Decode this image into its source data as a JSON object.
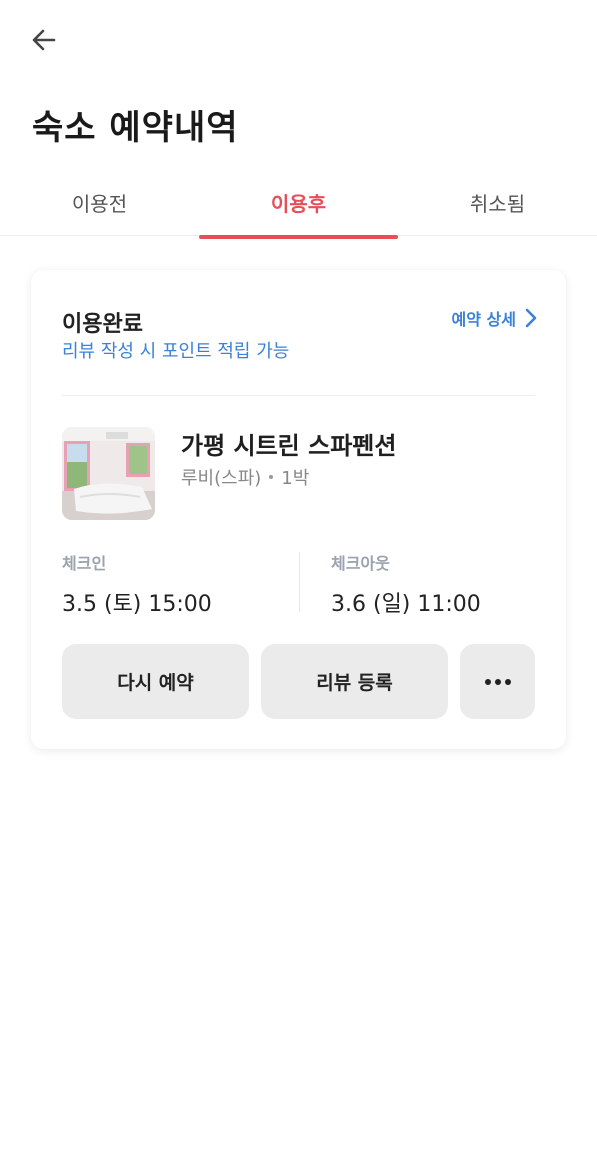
{
  "header": {
    "back_icon": "arrow-left-icon",
    "title": "숙소 예약내역"
  },
  "tabs": [
    {
      "label": "이용전",
      "active": false
    },
    {
      "label": "이용후",
      "active": true
    },
    {
      "label": "취소됨",
      "active": false
    }
  ],
  "colors": {
    "accent": "#e94e58",
    "link": "#3b82d6"
  },
  "reservation": {
    "status": "이용완료",
    "status_sub": "리뷰 작성 시 포인트 적립 가능",
    "detail_label": "예약 상세",
    "hotel_name": "가평 시트린 스파펜션",
    "room": "루비(스파)",
    "nights": "1박",
    "checkin_label": "체크인",
    "checkin_value": "3.5 (토) 15:00",
    "checkout_label": "체크아웃",
    "checkout_value": "3.6 (일) 11:00",
    "buttons": {
      "rebook": "다시 예약",
      "review": "리뷰 등록",
      "more_icon": "more-horizontal-icon"
    }
  }
}
